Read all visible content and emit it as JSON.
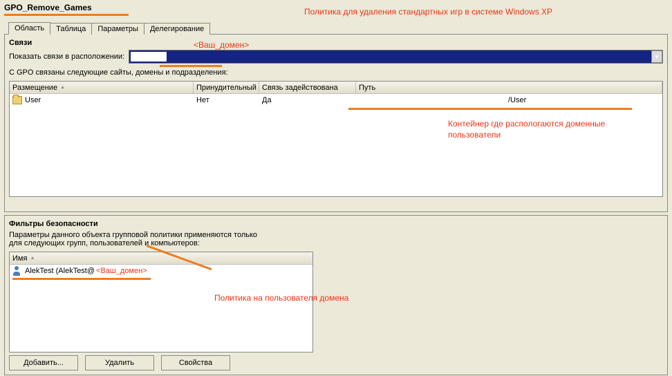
{
  "title": "GPO_Remove_Games",
  "tabs": {
    "t1": "Область",
    "t2": "Таблица",
    "t3": "Параметры",
    "t4": "Делегирование"
  },
  "links": {
    "section": "Связи",
    "show_label": "Показать связи в расположении:",
    "subtext": "С GPO связаны следующие сайты, домены и подразделения:",
    "cols": {
      "c1": "Размещение",
      "c2": "Принудительный",
      "c3": "Связь задействована",
      "c4": "Путь"
    },
    "row": {
      "loc": "User",
      "forced": "Нет",
      "enabled": "Да",
      "path": "/User"
    }
  },
  "security": {
    "title": "Фильтры безопасности",
    "desc1": "Параметры данного объекта групповой политики применяются только",
    "desc2": "для следующих групп, пользователей и компьютеров:",
    "col": "Имя",
    "entry": "AlekTest (AlekTest@"
  },
  "buttons": {
    "add": "Добавить...",
    "remove": "Удалить",
    "props": "Свойства"
  },
  "annotations": {
    "a1": "Политика для удаления стандартных игр в системе Windows XP",
    "a2": "<Ваш_домен>",
    "a3": "Контейнер где распологаются доменные пользователи",
    "a4": "<Ваш_домен>",
    "a5": "Политика на пользователя домена"
  }
}
